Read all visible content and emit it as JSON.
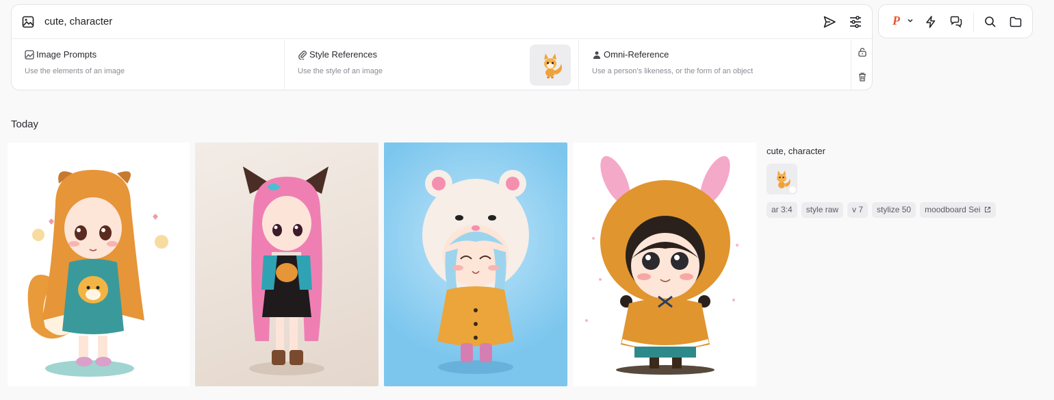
{
  "prompt": {
    "text": "cute, character"
  },
  "references": {
    "image_prompts": {
      "title": "Image Prompts",
      "subtitle": "Use the elements of an image"
    },
    "style_references": {
      "title": "Style References",
      "subtitle": "Use the style of an image"
    },
    "omni_reference": {
      "title": "Omni-Reference",
      "subtitle": "Use a person’s likeness, or the form of an object"
    }
  },
  "toolbar": {
    "profile_letter": "P",
    "icons": [
      "p-profile-icon",
      "chevron-down-icon",
      "lightning-icon",
      "chat-icon",
      "search-icon",
      "folder-icon"
    ]
  },
  "section": {
    "heading": "Today"
  },
  "gallery": [
    {
      "name": "gallery-image-1",
      "subject": "fox-girl"
    },
    {
      "name": "gallery-image-2",
      "subject": "pink-hair-girl"
    },
    {
      "name": "gallery-image-3",
      "subject": "bear-hood-girl"
    },
    {
      "name": "gallery-image-4",
      "subject": "bunny-hood-girl"
    }
  ],
  "details": {
    "prompt": "cute, character",
    "tags": [
      "ar 3:4",
      "style raw",
      "v 7",
      "stylize 50",
      "moodboard Sei"
    ]
  },
  "colors": {
    "accent_profile": "#e4572e",
    "tag_bg": "#ededf0",
    "page_bg": "#f9f9fa"
  }
}
